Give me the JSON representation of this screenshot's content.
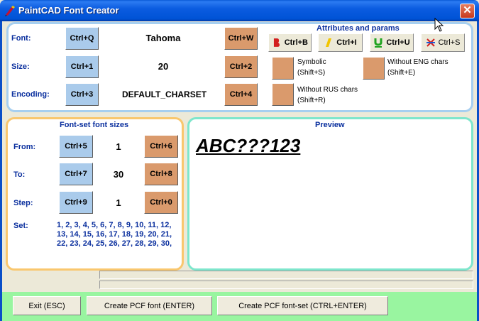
{
  "window": {
    "title": "PaintCAD Font Creator",
    "close_glyph": "✕"
  },
  "attributes": {
    "heading": "Attributes and params",
    "font": {
      "label": "Font:",
      "value": "Tahoma",
      "dec_key": "Ctrl+Q",
      "inc_key": "Ctrl+W"
    },
    "size": {
      "label": "Size:",
      "value": "20",
      "dec_key": "Ctrl+1",
      "inc_key": "Ctrl+2"
    },
    "encoding": {
      "label": "Encoding:",
      "value": "DEFAULT_CHARSET",
      "dec_key": "Ctrl+3",
      "inc_key": "Ctrl+4"
    },
    "style_buttons": [
      {
        "label": "Ctrl+B",
        "icon": "bold-icon"
      },
      {
        "label": "Ctrl+I",
        "icon": "italic-icon"
      },
      {
        "label": "Ctrl+U",
        "icon": "underline-icon"
      },
      {
        "label": "Ctrl+S",
        "icon": "strikeout-icon"
      }
    ],
    "options": {
      "symbolic": {
        "line1": "Symbolic",
        "line2": "(Shift+S)"
      },
      "without_eng": {
        "line1": "Without ENG chars",
        "line2": "(Shift+E)"
      },
      "without_rus": {
        "line1": "Without RUS chars",
        "line2": "(Shift+R)"
      }
    }
  },
  "font_set": {
    "heading": "Font-set font sizes",
    "from": {
      "label": "From:",
      "value": "1",
      "dec_key": "Ctrl+5",
      "inc_key": "Ctrl+6"
    },
    "to": {
      "label": "To:",
      "value": "30",
      "dec_key": "Ctrl+7",
      "inc_key": "Ctrl+8"
    },
    "step": {
      "label": "Step:",
      "value": "1",
      "dec_key": "Ctrl+9",
      "inc_key": "Ctrl+0"
    },
    "set_label": "Set:",
    "set_values": "1, 2, 3, 4, 5, 6, 7, 8, 9, 10, 11, 12, 13, 14, 15, 16, 17, 18, 19, 20, 21, 22, 23, 24, 25, 26, 27, 28, 29, 30,"
  },
  "preview": {
    "heading": "Preview",
    "sample_text": "ABC???123"
  },
  "footer": {
    "exit_label": "Exit (ESC)",
    "create_font_label": "Create PCF font (ENTER)",
    "create_fontset_label": "Create PCF font-set (CTRL+ENTER)"
  },
  "colors": {
    "title_bar": "#0053D6",
    "key_blue": "#AACBEB",
    "key_orange": "#DA9A6C",
    "attr_border": "#A6CFF0",
    "sizes_border": "#F9C76E",
    "preview_border": "#7EE6CC",
    "footer_bg": "#99F5A0",
    "label_blue": "#0A2F9E"
  }
}
